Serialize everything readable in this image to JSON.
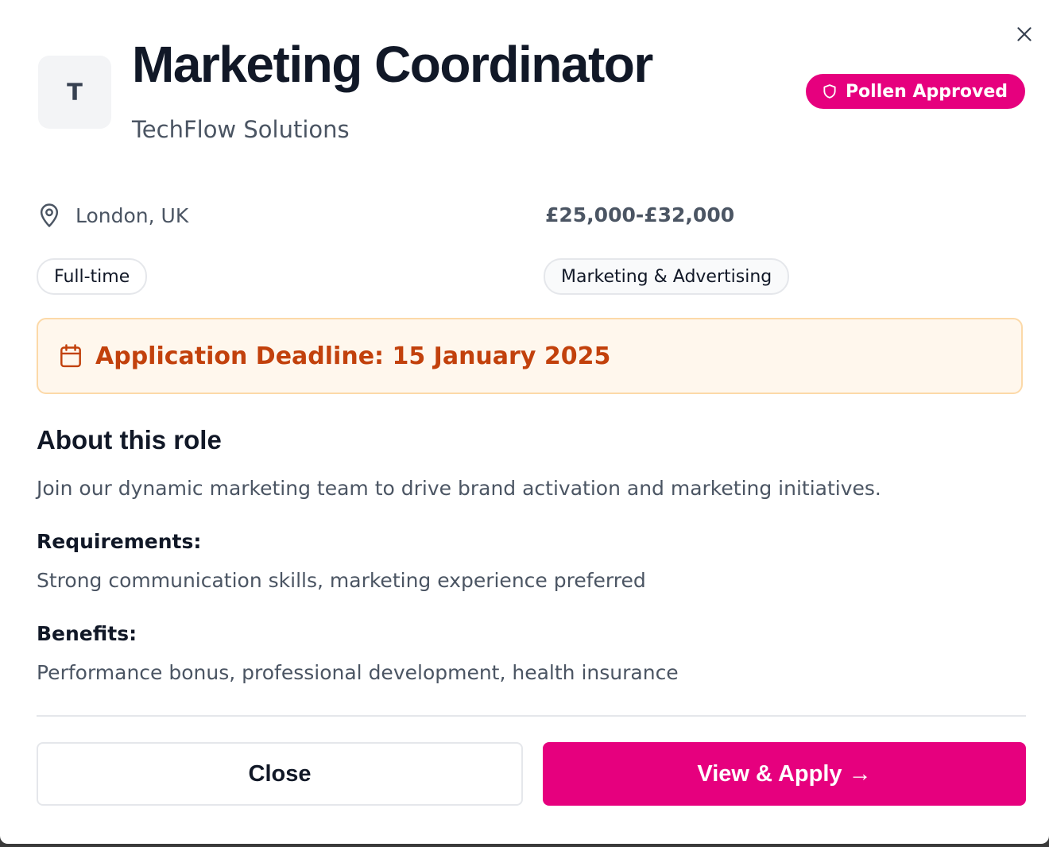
{
  "job": {
    "logo_letter": "T",
    "title": "Marketing Coordinator",
    "company": "TechFlow Solutions",
    "badge": "Pollen Approved",
    "location": "London, UK",
    "salary": "£25,000-£32,000",
    "employment_type": "Full-time",
    "category": "Marketing & Advertising",
    "deadline": "Application Deadline: 15 January 2025"
  },
  "about": {
    "heading": "About this role",
    "description": "Join our dynamic marketing team to drive brand activation and marketing initiatives.",
    "requirements_label": "Requirements:",
    "requirements": "Strong communication skills, marketing experience preferred",
    "benefits_label": "Benefits:",
    "benefits": "Performance bonus, professional development, health insurance"
  },
  "actions": {
    "close_label": "Close",
    "apply_label": "View & Apply →"
  },
  "colors": {
    "brand": "#e6007e",
    "deadline_text": "#c2410c",
    "deadline_bg": "#fff7ed"
  },
  "icons": {
    "close": "close-icon",
    "badge": "shield-icon",
    "location": "map-pin-icon",
    "deadline": "calendar-icon"
  }
}
